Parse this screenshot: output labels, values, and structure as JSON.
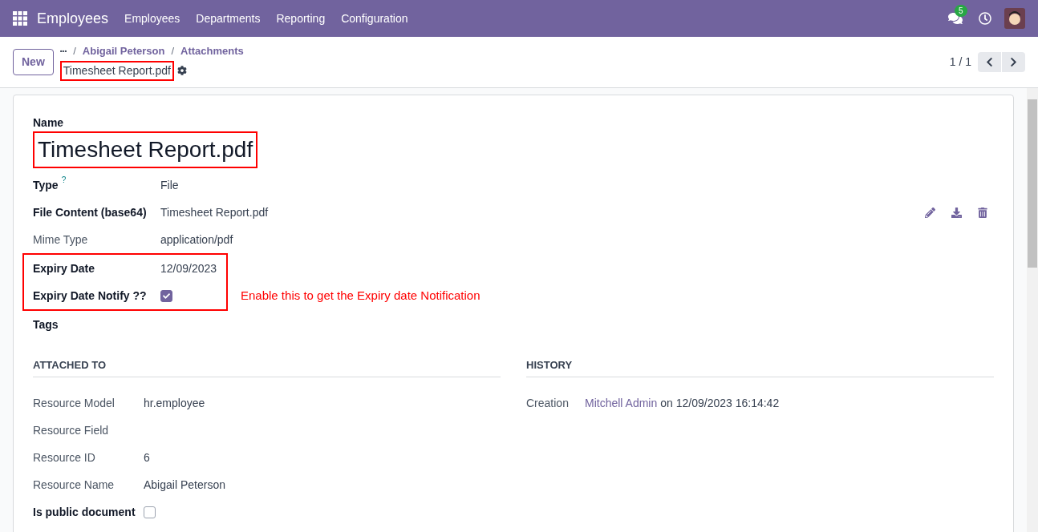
{
  "navbar": {
    "app_name": "Employees",
    "menu": [
      "Employees",
      "Departments",
      "Reporting",
      "Configuration"
    ],
    "chat_badge": "5"
  },
  "control_panel": {
    "new_button": "New",
    "breadcrumb_more": "•••",
    "breadcrumbs": [
      {
        "separator": "/",
        "label": "Abigail Peterson"
      },
      {
        "separator": "/",
        "label": "Attachments"
      }
    ],
    "record_title": "Timesheet Report.pdf",
    "record_title_highlighted": true,
    "pager": "1 / 1"
  },
  "form": {
    "name_label": "Name",
    "name_value": "Timesheet Report.pdf",
    "name_highlighted": true,
    "fields": [
      {
        "kind": "text",
        "label": "Type",
        "help": "?",
        "strong": true,
        "value": "File"
      },
      {
        "kind": "file",
        "label": "File Content (base64)",
        "strong": true,
        "value": "Timesheet Report.pdf"
      },
      {
        "kind": "text",
        "label": "Mime Type",
        "strong": false,
        "value": "application/pdf"
      },
      {
        "kind": "text",
        "label": "Expiry Date",
        "strong": true,
        "value": "12/09/2023",
        "highlighted": true
      },
      {
        "kind": "check",
        "label": "Expiry Date Notify ??",
        "strong": true,
        "checked": true,
        "highlighted": true
      },
      {
        "kind": "text",
        "label": "Tags",
        "strong": true
      }
    ],
    "annotation": "Enable this to get the Expiry date Notification",
    "attached_to": {
      "title": "ATTACHED TO",
      "fields": [
        {
          "kind": "text",
          "label": "Resource Model",
          "strong": false,
          "value": "hr.employee"
        },
        {
          "kind": "text",
          "label": "Resource Field",
          "strong": false
        },
        {
          "kind": "text",
          "label": "Resource ID",
          "strong": false,
          "value": "6"
        },
        {
          "kind": "text",
          "label": "Resource Name",
          "strong": false,
          "value": "Abigail Peterson"
        },
        {
          "kind": "check",
          "label": "Is public document",
          "strong": true,
          "checked": false
        }
      ]
    },
    "history": {
      "title": "HISTORY",
      "label": "Creation",
      "user": "Mitchell Admin",
      "text": "on 12/09/2023 16:14:42"
    }
  }
}
